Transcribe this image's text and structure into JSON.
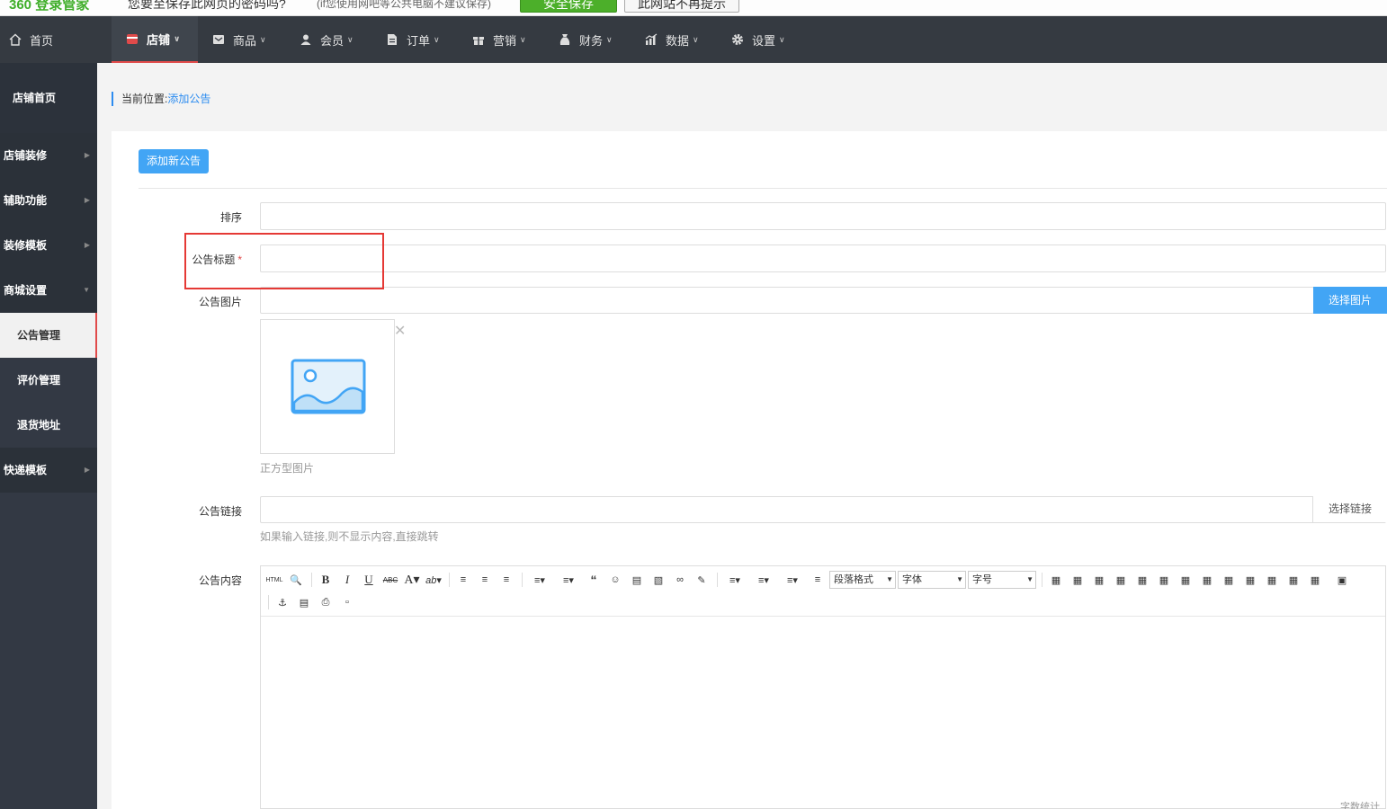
{
  "loginbar": {
    "brand": "360 登录管家",
    "message": "您要至保存此网页的密码吗?",
    "message_note": "(if您使用网吧等公共电脑不建议保存)",
    "save_label": "安全保存",
    "nomore_label": "此网站不再提示"
  },
  "topnav": {
    "home": "首页",
    "items": [
      {
        "label": "店铺",
        "icon": "store-icon",
        "active": true
      },
      {
        "label": "商品",
        "icon": "goods-icon"
      },
      {
        "label": "会员",
        "icon": "member-icon"
      },
      {
        "label": "订单",
        "icon": "order-icon"
      },
      {
        "label": "营销",
        "icon": "gift-icon"
      },
      {
        "label": "财务",
        "icon": "money-bag-icon"
      },
      {
        "label": "数据",
        "icon": "chart-icon"
      },
      {
        "label": "设置",
        "icon": "gear-icon"
      }
    ]
  },
  "sidebar": {
    "home": "店铺首页",
    "groups": [
      "店铺装修",
      "辅助功能",
      "装修模板",
      "商城设置",
      "快递模板"
    ],
    "subitems": [
      "公告管理",
      "评价管理",
      "退货地址"
    ]
  },
  "breadcrumb": {
    "prefix": "当前位置:",
    "current": "添加公告"
  },
  "form": {
    "add_button": "添加新公告",
    "sort_label": "排序",
    "sort_value": "",
    "title_label": "公告标题",
    "title_required": "*",
    "title_value": "",
    "image_label": "公告图片",
    "image_value": "",
    "image_button": "选择图片",
    "image_hint": "正方型图片",
    "link_label": "公告链接",
    "link_value": "",
    "link_button": "选择链接",
    "link_hint": "如果输入链接,则不显示内容,直接跳转",
    "content_label": "公告内容"
  },
  "editor": {
    "paragraph_select": "段落格式",
    "font_select": "字体",
    "size_select": "字号",
    "wordcount": "字数统计"
  },
  "colors": {
    "nav_bg": "#353a41",
    "accent_blue": "#42a5f5",
    "active_red": "#e04a4a"
  }
}
